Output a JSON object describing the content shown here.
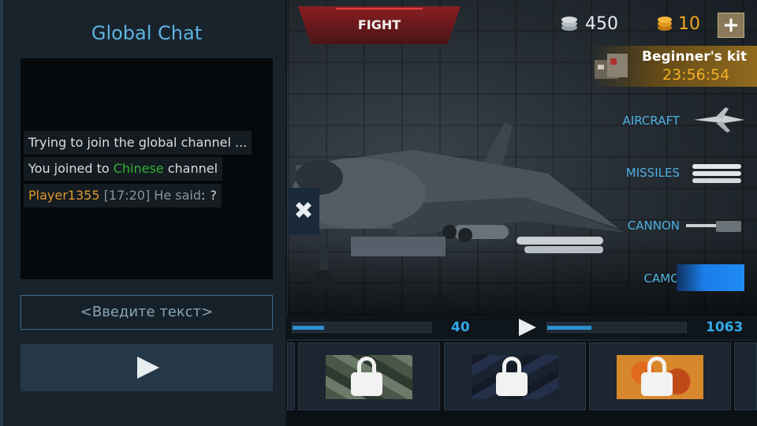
{
  "chat": {
    "title": "Global Chat",
    "messages": [
      {
        "text": "Trying to join the global channel ..."
      },
      {
        "prefix": "You joined to ",
        "highlight": "Chinese",
        "suffix": " channel"
      },
      {
        "player": "Player1355",
        "time": "[17:20]",
        "said": " He said",
        "colon": ":",
        "content": "?"
      }
    ],
    "input_placeholder": "<Введите текст>",
    "send_icon": "play-icon"
  },
  "topbar": {
    "fight_label": "FIGHT",
    "silver": "450",
    "gold": "10",
    "add_currency_label": "+",
    "silver_icon": "silver-coins-icon",
    "gold_icon": "gold-coins-icon"
  },
  "kit": {
    "title": "Beginner's kit",
    "timer": "23:56:54"
  },
  "loadout": {
    "items": [
      {
        "label": "AIRCRAFT",
        "icon": "aircraft-icon"
      },
      {
        "label": "MISSILES",
        "icon": "missiles-icon"
      },
      {
        "label": "CANNON",
        "icon": "cannon-icon"
      },
      {
        "label": "CAMO",
        "icon": "camo-swatch"
      }
    ]
  },
  "progress": {
    "left_value": "40",
    "right_value": "1063",
    "left_fill": 0.23,
    "right_fill": 0.32
  },
  "close_label": "✖",
  "colors": {
    "accent_blue": "#4fb0e0",
    "gold": "#f0a820",
    "fight_red": "#8a1f22"
  }
}
